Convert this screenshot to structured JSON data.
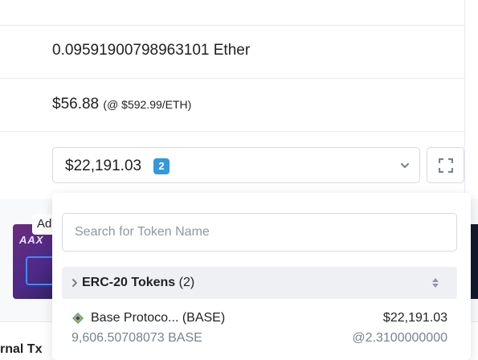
{
  "overview": {
    "balance": "0.09591900798963101 Ether",
    "value": "$56.88",
    "eth_price": "(@ $592.99/ETH)"
  },
  "token_holdings": {
    "total": "$22,191.03",
    "count_badge": "2",
    "dropdown_icon": "chevron-down-icon",
    "expand_icon": "expand-icon"
  },
  "token_dropdown": {
    "search_placeholder": "Search for Token Name",
    "group": {
      "label": "ERC-20 Tokens",
      "count": "(2)"
    },
    "tokens": [
      {
        "name": "Base Protoco... (BASE)",
        "value": "$22,191.03",
        "quantity": "9,606.50708073 BASE",
        "rate": "@2.3100000000"
      }
    ]
  },
  "ad": {
    "label": "Ad",
    "logo_text": "AAX"
  },
  "tabs": {
    "partial_label": "rnal Tx"
  }
}
